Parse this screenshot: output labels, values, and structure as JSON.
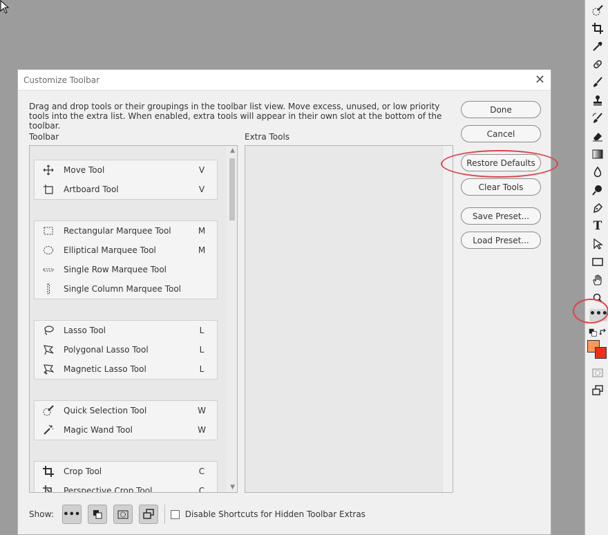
{
  "dialog": {
    "title": "Customize Toolbar",
    "description": "Drag and drop tools or their groupings in the toolbar list view. Move excess, unused, or low priority tools into the extra list. When enabled, extra tools will appear in their own slot at the bottom of the toolbar.",
    "toolbar_label": "Toolbar",
    "extra_label": "Extra Tools",
    "close_glyph": "✕"
  },
  "toolbar_groups": [
    {
      "tools": [
        {
          "name": "Move Tool",
          "key": "V",
          "icon": "move-icon"
        },
        {
          "name": "Artboard Tool",
          "key": "V",
          "icon": "artboard-icon"
        }
      ]
    },
    {
      "tools": [
        {
          "name": "Rectangular Marquee Tool",
          "key": "M",
          "icon": "rect-marquee-icon"
        },
        {
          "name": "Elliptical Marquee Tool",
          "key": "M",
          "icon": "ellipse-marquee-icon"
        },
        {
          "name": "Single Row Marquee Tool",
          "key": "",
          "icon": "row-marquee-icon"
        },
        {
          "name": "Single Column Marquee Tool",
          "key": "",
          "icon": "column-marquee-icon"
        }
      ]
    },
    {
      "tools": [
        {
          "name": "Lasso Tool",
          "key": "L",
          "icon": "lasso-icon"
        },
        {
          "name": "Polygonal Lasso Tool",
          "key": "L",
          "icon": "polygonal-lasso-icon"
        },
        {
          "name": "Magnetic Lasso Tool",
          "key": "L",
          "icon": "magnetic-lasso-icon"
        }
      ]
    },
    {
      "tools": [
        {
          "name": "Quick Selection Tool",
          "key": "W",
          "icon": "quick-selection-icon"
        },
        {
          "name": "Magic Wand Tool",
          "key": "W",
          "icon": "magic-wand-icon"
        }
      ]
    },
    {
      "tools": [
        {
          "name": "Crop Tool",
          "key": "C",
          "icon": "crop-icon"
        },
        {
          "name": "Perspective Crop Tool",
          "key": "C",
          "icon": "perspective-crop-icon"
        }
      ]
    }
  ],
  "buttons": {
    "done": "Done",
    "cancel": "Cancel",
    "restore": "Restore Defaults",
    "clear": "Clear Tools",
    "save_preset": "Save Preset...",
    "load_preset": "Load Preset..."
  },
  "show": {
    "label": "Show:",
    "more_glyph": "•••",
    "checkbox_label": "Disable Shortcuts for Hidden Toolbar Extras",
    "checkbox_checked": false
  },
  "ps_toolbar": {
    "more_glyph": "•••",
    "type_glyph": "T",
    "foreground_color": "#f99957",
    "background_color": "#f02e18"
  },
  "colors": {
    "highlight_circle": "#e0404a"
  }
}
